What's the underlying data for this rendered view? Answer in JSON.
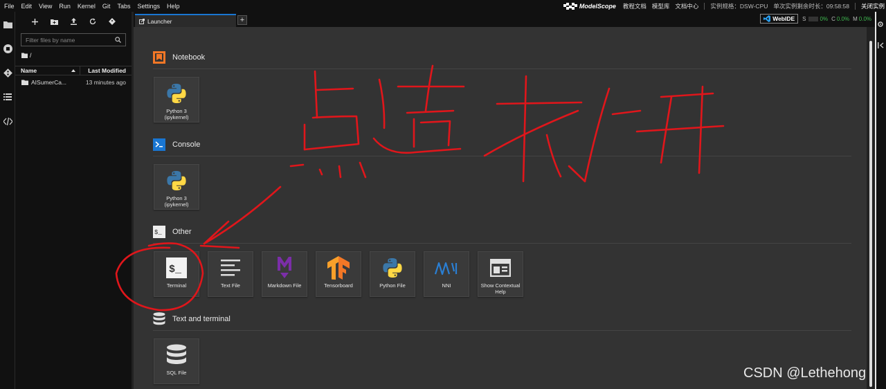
{
  "menubar": {
    "items": [
      "File",
      "Edit",
      "View",
      "Run",
      "Kernel",
      "Git",
      "Tabs",
      "Settings",
      "Help"
    ],
    "brand": "ModelScope",
    "links": [
      "教程文档",
      "模型库",
      "文档中心"
    ],
    "instance_spec": "实例规格：DSW-CPU",
    "remaining_time": "单次实例剩余时长：09:58:58",
    "close_instance": "关闭实例"
  },
  "filebrowser": {
    "filter_placeholder": "Filter files by name",
    "path": "/",
    "col_name": "Name",
    "col_modified": "Last Modified",
    "files": [
      {
        "name": "AISumerCa...",
        "modified": "13 minutes ago"
      }
    ]
  },
  "tabs": {
    "active": "Launcher",
    "add": "+"
  },
  "status": {
    "webide": "WebIDE",
    "s_label": "S",
    "s_value": "0%",
    "c_label": "C",
    "c_value": "0.0%",
    "m_label": "M",
    "m_value": "0.0%"
  },
  "launcher": {
    "sections": {
      "notebook": "Notebook",
      "console": "Console",
      "other": "Other",
      "text_terminal": "Text and terminal"
    },
    "cards": {
      "notebook_py3": [
        "Python 3",
        "(ipykernel)"
      ],
      "console_py3": [
        "Python 3",
        "(ipykernel)"
      ],
      "terminal": "Terminal",
      "text_file": "Text File",
      "markdown_file": "Markdown File",
      "tensorboard": "Tensorboard",
      "python_file": "Python File",
      "nni": "NNI",
      "contextual_help": [
        "Show Contextual",
        "Help"
      ],
      "sql_file": "SQL File"
    }
  },
  "annotation": {
    "handwritten_text": "点击打开",
    "color": "#e0161b"
  },
  "watermark": "CSDN @Lethehong",
  "colors": {
    "accent": "#1976d2",
    "launcher_bg": "#333333",
    "python_blue": "#3b77a8",
    "python_yellow": "#ffd845",
    "notebook_orange": "#f37726",
    "markdown_purple": "#7b2ea8",
    "tensorboard_orange": "#f9a02a",
    "nni_blue": "#2a7fd4"
  }
}
